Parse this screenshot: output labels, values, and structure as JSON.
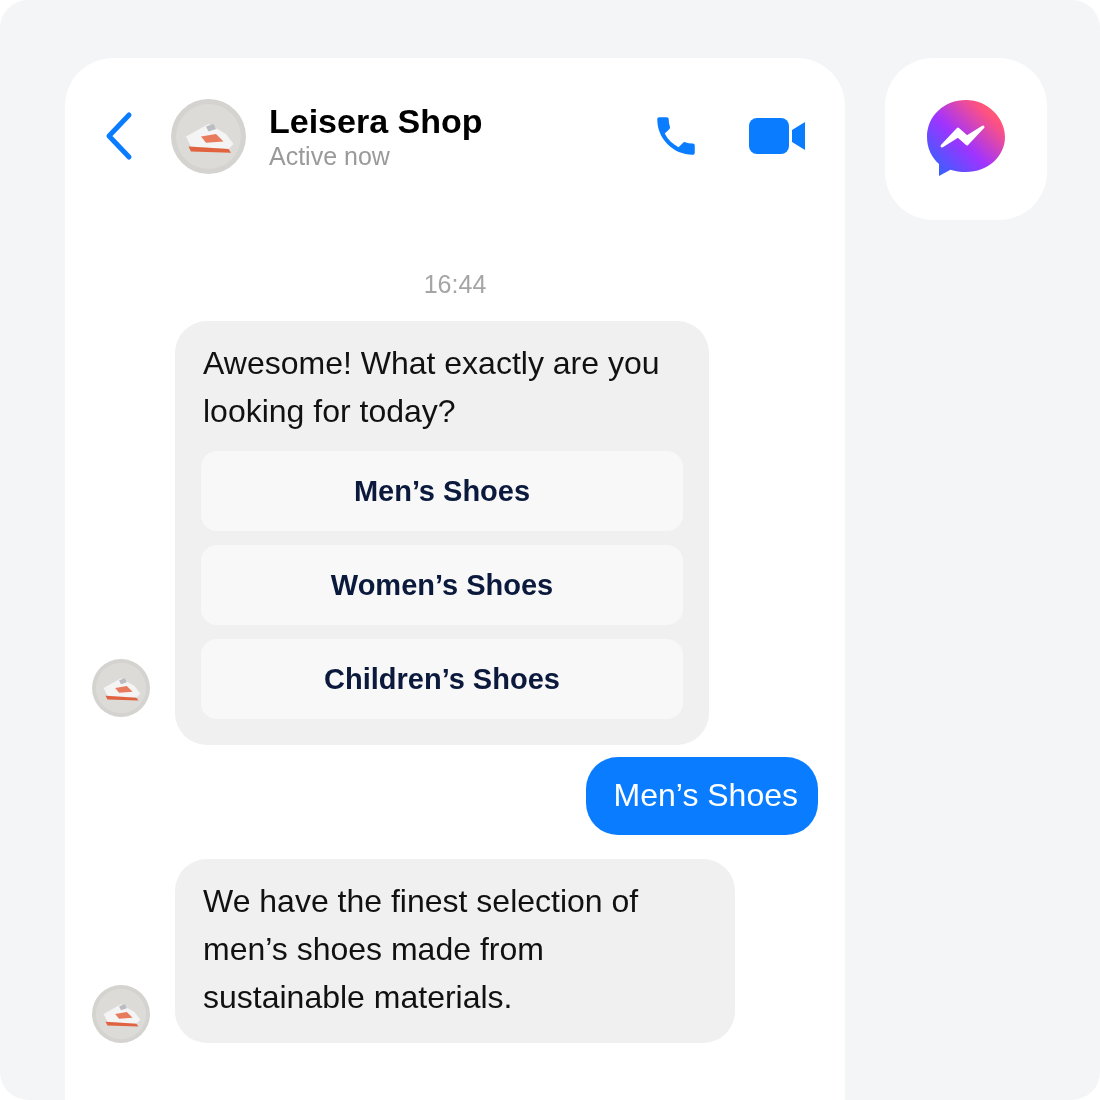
{
  "header": {
    "name": "Leisera Shop",
    "status": "Active now"
  },
  "timestamp": "16:44",
  "messages": [
    {
      "kind": "incoming",
      "text": "Awesome! What exactly are you looking for today?",
      "quick_replies": [
        "Men’s Shoes",
        "Women’s Shoes",
        "Children’s Shoes"
      ]
    },
    {
      "kind": "outgoing",
      "text": "Men’s Shoes"
    },
    {
      "kind": "incoming",
      "text": "We have the finest selection of men’s shoes made from sustainable materials."
    }
  ]
}
